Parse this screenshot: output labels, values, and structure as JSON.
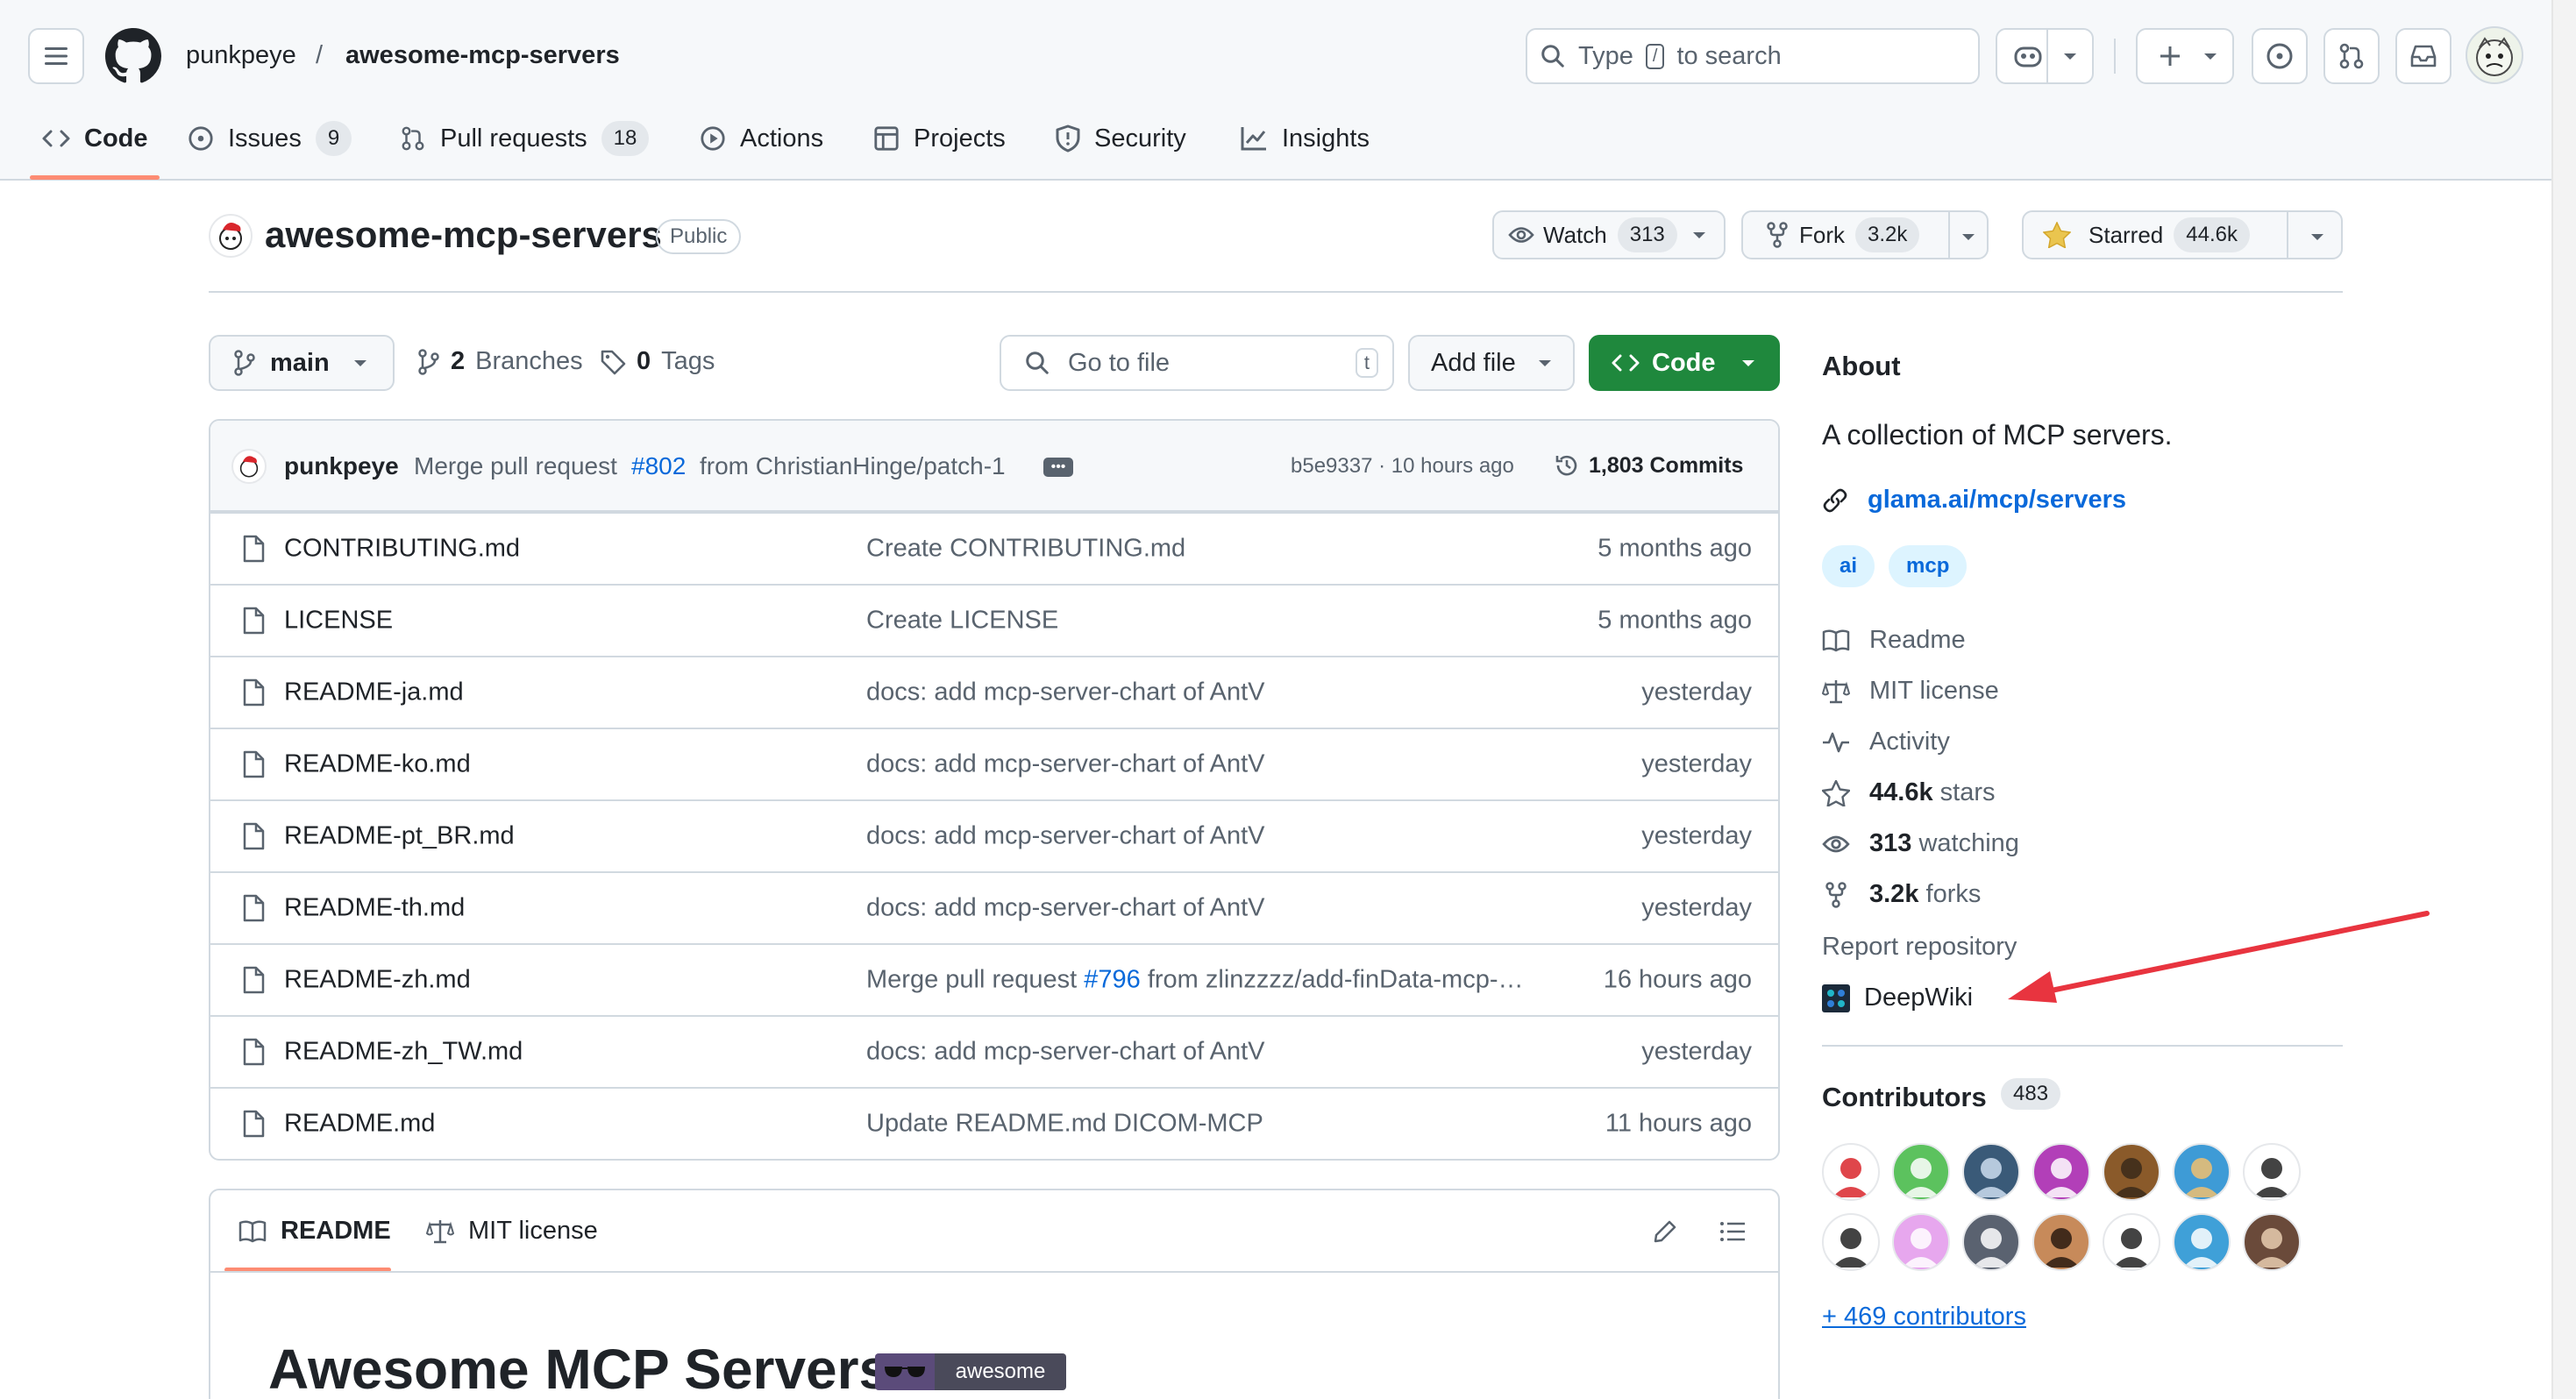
{
  "header": {
    "owner": "punkpeye",
    "slash": "/",
    "repo": "awesome-mcp-servers",
    "search_prefix": "Type",
    "search_key": "/",
    "search_suffix": "to search"
  },
  "tabs": [
    {
      "label": "Code",
      "count": ""
    },
    {
      "label": "Issues",
      "count": "9"
    },
    {
      "label": "Pull requests",
      "count": "18"
    },
    {
      "label": "Actions",
      "count": ""
    },
    {
      "label": "Projects",
      "count": ""
    },
    {
      "label": "Security",
      "count": ""
    },
    {
      "label": "Insights",
      "count": ""
    }
  ],
  "repo": {
    "title": "awesome-mcp-servers",
    "visibility": "Public",
    "watch_label": "Watch",
    "watch_count": "313",
    "fork_label": "Fork",
    "fork_count": "3.2k",
    "star_label": "Starred",
    "star_count": "44.6k"
  },
  "branchbar": {
    "branch": "main",
    "branches_count": "2",
    "branches_label": "Branches",
    "tags_count": "0",
    "tags_label": "Tags",
    "goto_placeholder": "Go to file",
    "goto_key": "t",
    "add_file": "Add file",
    "code": "Code"
  },
  "commit": {
    "author": "punkpeye",
    "message_pre": "Merge pull request",
    "pr": "#802",
    "message_post": "from ChristianHinge/patch-1",
    "meta": "b5e9337 · 10 hours ago",
    "commits": "1,803 Commits"
  },
  "files": [
    {
      "name": "CONTRIBUTING.md",
      "msg": "Create CONTRIBUTING.md",
      "msg_link": "",
      "msg_post": "",
      "date": "5 months ago"
    },
    {
      "name": "LICENSE",
      "msg": "Create LICENSE",
      "msg_link": "",
      "msg_post": "",
      "date": "5 months ago"
    },
    {
      "name": "README-ja.md",
      "msg": "docs: add mcp-server-chart of AntV",
      "msg_link": "",
      "msg_post": "",
      "date": "yesterday"
    },
    {
      "name": "README-ko.md",
      "msg": "docs: add mcp-server-chart of AntV",
      "msg_link": "",
      "msg_post": "",
      "date": "yesterday"
    },
    {
      "name": "README-pt_BR.md",
      "msg": "docs: add mcp-server-chart of AntV",
      "msg_link": "",
      "msg_post": "",
      "date": "yesterday"
    },
    {
      "name": "README-th.md",
      "msg": "docs: add mcp-server-chart of AntV",
      "msg_link": "",
      "msg_post": "",
      "date": "yesterday"
    },
    {
      "name": "README-zh.md",
      "msg": "Merge pull request ",
      "msg_link": "#796",
      "msg_post": " from zlinzzzz/add-finData-mcp-…",
      "date": "16 hours ago"
    },
    {
      "name": "README-zh_TW.md",
      "msg": "docs: add mcp-server-chart of AntV",
      "msg_link": "",
      "msg_post": "",
      "date": "yesterday"
    },
    {
      "name": "README.md",
      "msg": "Update README.md DICOM-MCP",
      "msg_link": "",
      "msg_post": "",
      "date": "11 hours ago"
    }
  ],
  "readme": {
    "tab_readme": "README",
    "tab_license": "MIT license",
    "heading": "Awesome MCP Servers",
    "badge": "awesome"
  },
  "about": {
    "title": "About",
    "description": "A collection of MCP servers.",
    "link": "glama.ai/mcp/servers",
    "topics": [
      "ai",
      "mcp"
    ],
    "readme": "Readme",
    "license": "MIT license",
    "activity": "Activity",
    "stars_num": "44.6k",
    "stars_label": "stars",
    "watching_num": "313",
    "watching_label": "watching",
    "forks_num": "3.2k",
    "forks_label": "forks",
    "report": "Report repository",
    "deepwiki": "DeepWiki"
  },
  "contributors": {
    "title": "Contributors",
    "count": "483",
    "more": "+ 469 contributors"
  },
  "colors": {
    "accent": "#0969da",
    "green": "#1f883d",
    "annotation_arrow": "#e8343f",
    "tab_underline": "#fd8c73"
  }
}
